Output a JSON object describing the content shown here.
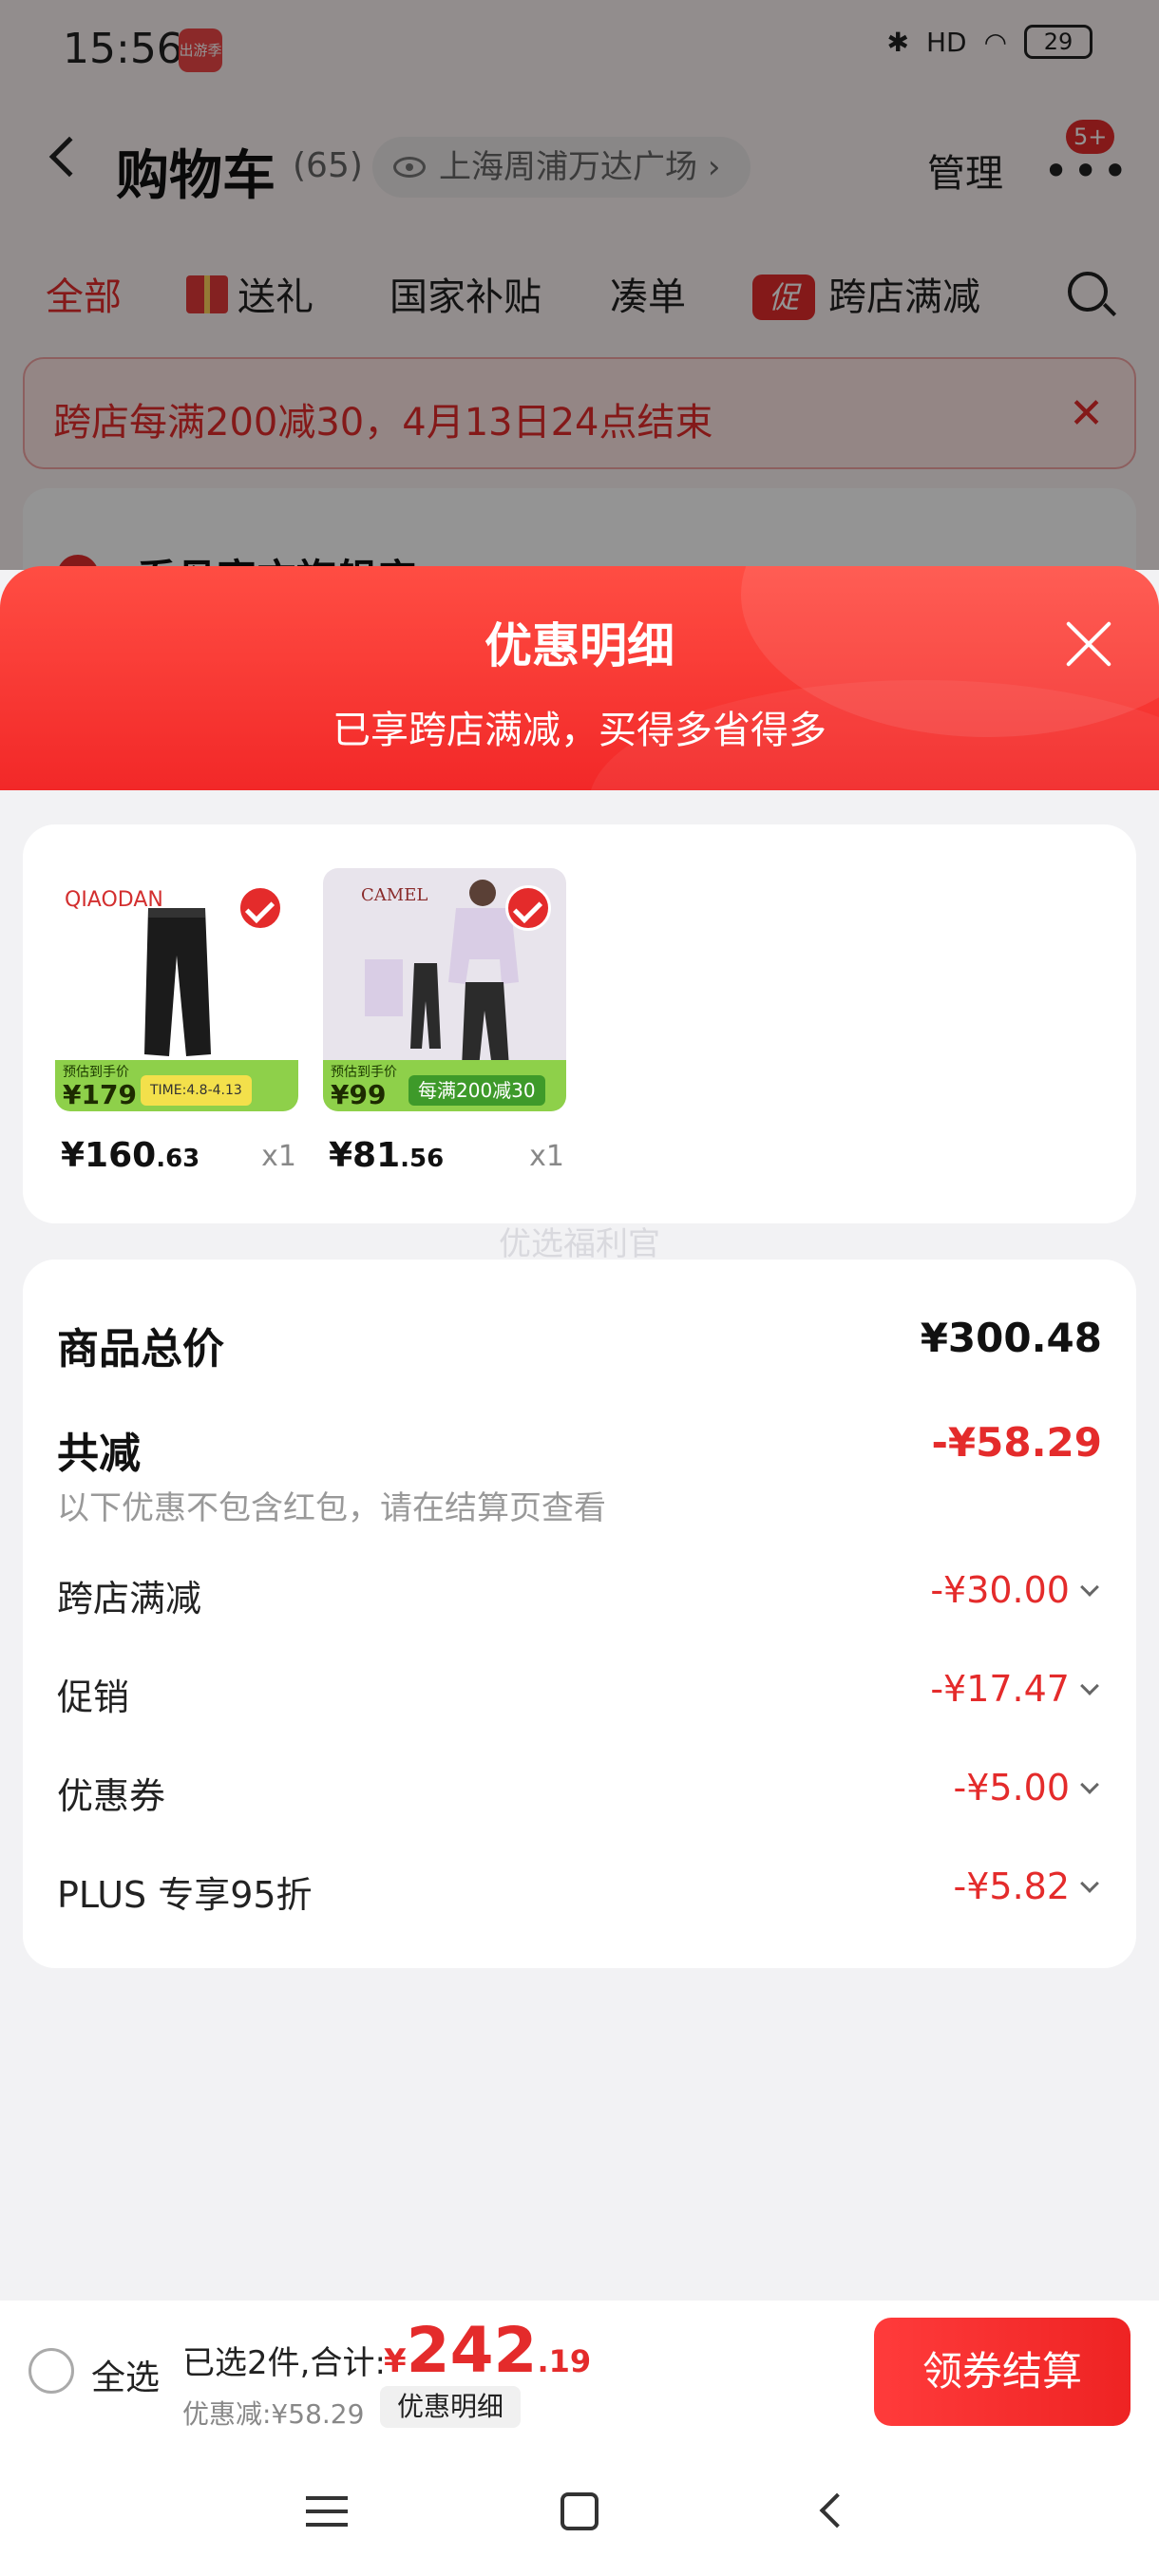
{
  "status_bar": {
    "time": "15:56",
    "app_badge": "出游季",
    "network": "HD",
    "battery": "29"
  },
  "cart_header": {
    "title": "购物车",
    "count": "(65)",
    "location": "上海周浦万达广场",
    "manage": "管理",
    "more_badge": "5+"
  },
  "tabs": [
    "全部",
    "送礼",
    "国家补贴",
    "凑单",
    "跨店满减"
  ],
  "promo_tag": "促",
  "banner": {
    "text": "跨店每满200减30，4月13日24点结束"
  },
  "store": {
    "name": "乔丹官方旗舰店"
  },
  "sheet": {
    "title": "优惠明细",
    "subtitle": "已享跨店满减，买得多省得多"
  },
  "products": [
    {
      "brand": "QIAODAN",
      "price_int": "¥160",
      "price_dec": ".63",
      "qty": "x1",
      "strip_label": "预估到手价",
      "strip_price": "¥179",
      "strip_extra": "TIME:4.8-4.13",
      "strip_color": "#8ed04a"
    },
    {
      "brand": "CAMEL",
      "price_int": "¥81",
      "price_dec": ".56",
      "qty": "x1",
      "strip_label": "预估到手价",
      "strip_price": "¥99",
      "strip_extra": "每满200减30",
      "strip_color": "#8ed04a"
    }
  ],
  "watermark": "优选福利官",
  "summary": {
    "total_label": "商品总价",
    "total_value": "¥300.48",
    "reduce_label": "共减",
    "reduce_value": "-¥58.29",
    "note": "以下优惠不包含红包，请在结算页查看",
    "items": [
      {
        "label": "跨店满减",
        "value": "-¥30.00"
      },
      {
        "label": "促销",
        "value": "-¥17.47"
      },
      {
        "label": "优惠券",
        "value": "-¥5.00"
      },
      {
        "label": "PLUS 专享95折",
        "value": "-¥5.82"
      }
    ]
  },
  "bottom_bar": {
    "select_all": "全选",
    "selected_summary": "已选2件,合计:",
    "total_yen": "¥",
    "total_int": "242",
    "total_dec": ".19",
    "discount": "优惠减:¥58.29",
    "detail_chip": "优惠明细",
    "checkout": "领券结算"
  },
  "colors": {
    "accent": "#e42b2b",
    "header_gradient_top": "#ff4d43",
    "header_gradient_bottom": "#f22828"
  }
}
